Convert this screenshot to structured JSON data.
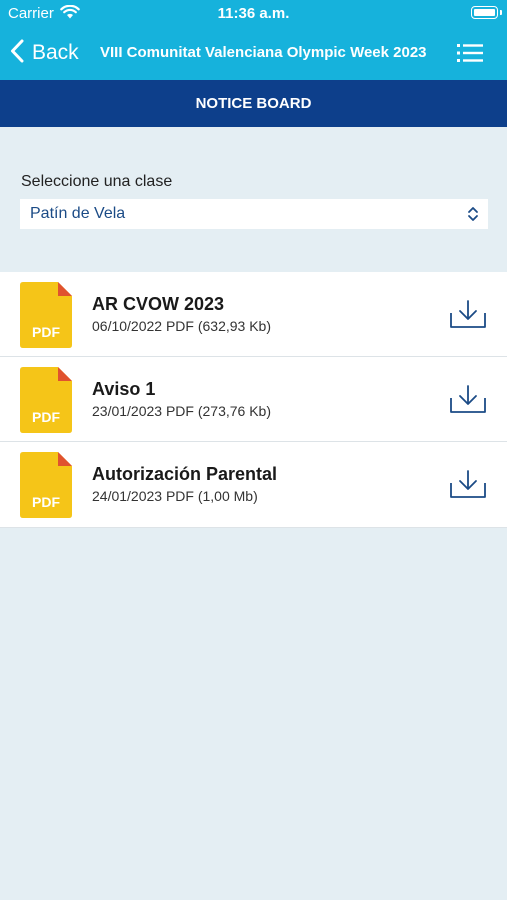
{
  "status": {
    "carrier": "Carrier",
    "time": "11:36 a.m."
  },
  "nav": {
    "back_label": "Back",
    "title": "VIII Comunitat Valenciana Olympic Week 2023"
  },
  "section": {
    "title": "NOTICE BOARD"
  },
  "class_picker": {
    "label": "Seleccione una clase",
    "value": "Patín de Vela"
  },
  "documents": [
    {
      "title": "AR CVOW 2023",
      "meta": "06/10/2022 PDF (632,93 Kb)",
      "icon_label": "PDF"
    },
    {
      "title": "Aviso 1",
      "meta": "23/01/2023 PDF (273,76 Kb)",
      "icon_label": "PDF"
    },
    {
      "title": "Autorización Parental",
      "meta": "24/01/2023 PDF (1,00 Mb)",
      "icon_label": "PDF"
    }
  ],
  "colors": {
    "header": "#16b2dc",
    "section_bar": "#0d3f8b",
    "background": "#e4eef3",
    "pdf_icon": "#f5c518",
    "accent": "#1b4b86"
  }
}
